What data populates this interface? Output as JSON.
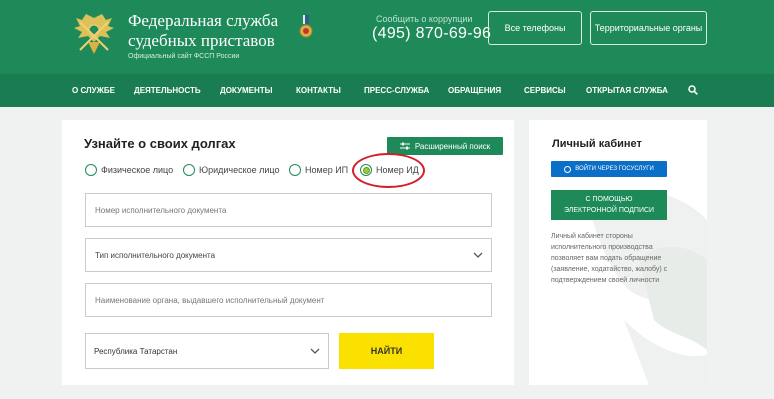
{
  "header": {
    "title_line1": "Федеральная служба",
    "title_line2": "судебных приставов",
    "subtitle": "Официальный сайт ФССП России",
    "corruption_label": "Сообщить о коррупции",
    "phone": "(495) 870-69-96",
    "all_phones_label": "Все телефоны",
    "territorial_label": "Территориальные органы"
  },
  "nav": {
    "items": [
      "О СЛУЖБЕ",
      "ДЕЯТЕЛЬНОСТЬ",
      "ДОКУМЕНТЫ",
      "КОНТАКТЫ",
      "ПРЕСС-СЛУЖБА",
      "ОБРАЩЕНИЯ",
      "СЕРВИСЫ",
      "ОТКРЫТАЯ СЛУЖБА"
    ],
    "search_icon": "search-icon"
  },
  "debt_search": {
    "title": "Узнайте о своих долгах",
    "advanced_label": "Расширенный поиск",
    "radios": [
      {
        "label": "Физическое лицо",
        "selected": false
      },
      {
        "label": "Юридическое лицо",
        "selected": false
      },
      {
        "label": "Номер ИП",
        "selected": false
      },
      {
        "label": "Номер ИД",
        "selected": true
      }
    ],
    "doc_number_placeholder": "Номер исполнительного документа",
    "doc_type_value": "Тип исполнительного документа",
    "issuer_placeholder": "Наименование органа, выдавшего исполнительный документ",
    "region_value": "Республика Татарстан",
    "find_label": "НАЙТИ"
  },
  "cabinet": {
    "title": "Личный кабинет",
    "gosuslugi_label": "ВОЙТИ ЧЕРЕЗ ГОСУСЛУГИ",
    "signature_line1": "С ПОМОЩЬЮ",
    "signature_line2": "ЭЛЕКТРОННОЙ ПОДПИСИ",
    "description": "Личный кабинет стороны исполнительного производства позволяет вам подать обращение (заявление, ходатайство, жалобу) с подтверждением своей личности"
  },
  "colors": {
    "header": "#1e8a5a",
    "nav": "#1a7c51",
    "accent_yellow": "#fae100",
    "gos_blue": "#0b6ec7",
    "highlight_red": "#d31f2a"
  }
}
